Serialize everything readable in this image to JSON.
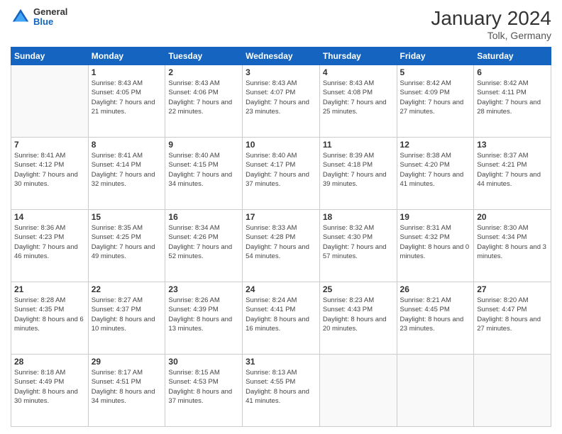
{
  "header": {
    "logo_line1": "General",
    "logo_line2": "Blue",
    "title": "January 2024",
    "subtitle": "Tolk, Germany"
  },
  "weekdays": [
    "Sunday",
    "Monday",
    "Tuesday",
    "Wednesday",
    "Thursday",
    "Friday",
    "Saturday"
  ],
  "weeks": [
    [
      {
        "day": "",
        "sunrise": "",
        "sunset": "",
        "daylight": ""
      },
      {
        "day": "1",
        "sunrise": "Sunrise: 8:43 AM",
        "sunset": "Sunset: 4:05 PM",
        "daylight": "Daylight: 7 hours and 21 minutes."
      },
      {
        "day": "2",
        "sunrise": "Sunrise: 8:43 AM",
        "sunset": "Sunset: 4:06 PM",
        "daylight": "Daylight: 7 hours and 22 minutes."
      },
      {
        "day": "3",
        "sunrise": "Sunrise: 8:43 AM",
        "sunset": "Sunset: 4:07 PM",
        "daylight": "Daylight: 7 hours and 23 minutes."
      },
      {
        "day": "4",
        "sunrise": "Sunrise: 8:43 AM",
        "sunset": "Sunset: 4:08 PM",
        "daylight": "Daylight: 7 hours and 25 minutes."
      },
      {
        "day": "5",
        "sunrise": "Sunrise: 8:42 AM",
        "sunset": "Sunset: 4:09 PM",
        "daylight": "Daylight: 7 hours and 27 minutes."
      },
      {
        "day": "6",
        "sunrise": "Sunrise: 8:42 AM",
        "sunset": "Sunset: 4:11 PM",
        "daylight": "Daylight: 7 hours and 28 minutes."
      }
    ],
    [
      {
        "day": "7",
        "sunrise": "Sunrise: 8:41 AM",
        "sunset": "Sunset: 4:12 PM",
        "daylight": "Daylight: 7 hours and 30 minutes."
      },
      {
        "day": "8",
        "sunrise": "Sunrise: 8:41 AM",
        "sunset": "Sunset: 4:14 PM",
        "daylight": "Daylight: 7 hours and 32 minutes."
      },
      {
        "day": "9",
        "sunrise": "Sunrise: 8:40 AM",
        "sunset": "Sunset: 4:15 PM",
        "daylight": "Daylight: 7 hours and 34 minutes."
      },
      {
        "day": "10",
        "sunrise": "Sunrise: 8:40 AM",
        "sunset": "Sunset: 4:17 PM",
        "daylight": "Daylight: 7 hours and 37 minutes."
      },
      {
        "day": "11",
        "sunrise": "Sunrise: 8:39 AM",
        "sunset": "Sunset: 4:18 PM",
        "daylight": "Daylight: 7 hours and 39 minutes."
      },
      {
        "day": "12",
        "sunrise": "Sunrise: 8:38 AM",
        "sunset": "Sunset: 4:20 PM",
        "daylight": "Daylight: 7 hours and 41 minutes."
      },
      {
        "day": "13",
        "sunrise": "Sunrise: 8:37 AM",
        "sunset": "Sunset: 4:21 PM",
        "daylight": "Daylight: 7 hours and 44 minutes."
      }
    ],
    [
      {
        "day": "14",
        "sunrise": "Sunrise: 8:36 AM",
        "sunset": "Sunset: 4:23 PM",
        "daylight": "Daylight: 7 hours and 46 minutes."
      },
      {
        "day": "15",
        "sunrise": "Sunrise: 8:35 AM",
        "sunset": "Sunset: 4:25 PM",
        "daylight": "Daylight: 7 hours and 49 minutes."
      },
      {
        "day": "16",
        "sunrise": "Sunrise: 8:34 AM",
        "sunset": "Sunset: 4:26 PM",
        "daylight": "Daylight: 7 hours and 52 minutes."
      },
      {
        "day": "17",
        "sunrise": "Sunrise: 8:33 AM",
        "sunset": "Sunset: 4:28 PM",
        "daylight": "Daylight: 7 hours and 54 minutes."
      },
      {
        "day": "18",
        "sunrise": "Sunrise: 8:32 AM",
        "sunset": "Sunset: 4:30 PM",
        "daylight": "Daylight: 7 hours and 57 minutes."
      },
      {
        "day": "19",
        "sunrise": "Sunrise: 8:31 AM",
        "sunset": "Sunset: 4:32 PM",
        "daylight": "Daylight: 8 hours and 0 minutes."
      },
      {
        "day": "20",
        "sunrise": "Sunrise: 8:30 AM",
        "sunset": "Sunset: 4:34 PM",
        "daylight": "Daylight: 8 hours and 3 minutes."
      }
    ],
    [
      {
        "day": "21",
        "sunrise": "Sunrise: 8:28 AM",
        "sunset": "Sunset: 4:35 PM",
        "daylight": "Daylight: 8 hours and 6 minutes."
      },
      {
        "day": "22",
        "sunrise": "Sunrise: 8:27 AM",
        "sunset": "Sunset: 4:37 PM",
        "daylight": "Daylight: 8 hours and 10 minutes."
      },
      {
        "day": "23",
        "sunrise": "Sunrise: 8:26 AM",
        "sunset": "Sunset: 4:39 PM",
        "daylight": "Daylight: 8 hours and 13 minutes."
      },
      {
        "day": "24",
        "sunrise": "Sunrise: 8:24 AM",
        "sunset": "Sunset: 4:41 PM",
        "daylight": "Daylight: 8 hours and 16 minutes."
      },
      {
        "day": "25",
        "sunrise": "Sunrise: 8:23 AM",
        "sunset": "Sunset: 4:43 PM",
        "daylight": "Daylight: 8 hours and 20 minutes."
      },
      {
        "day": "26",
        "sunrise": "Sunrise: 8:21 AM",
        "sunset": "Sunset: 4:45 PM",
        "daylight": "Daylight: 8 hours and 23 minutes."
      },
      {
        "day": "27",
        "sunrise": "Sunrise: 8:20 AM",
        "sunset": "Sunset: 4:47 PM",
        "daylight": "Daylight: 8 hours and 27 minutes."
      }
    ],
    [
      {
        "day": "28",
        "sunrise": "Sunrise: 8:18 AM",
        "sunset": "Sunset: 4:49 PM",
        "daylight": "Daylight: 8 hours and 30 minutes."
      },
      {
        "day": "29",
        "sunrise": "Sunrise: 8:17 AM",
        "sunset": "Sunset: 4:51 PM",
        "daylight": "Daylight: 8 hours and 34 minutes."
      },
      {
        "day": "30",
        "sunrise": "Sunrise: 8:15 AM",
        "sunset": "Sunset: 4:53 PM",
        "daylight": "Daylight: 8 hours and 37 minutes."
      },
      {
        "day": "31",
        "sunrise": "Sunrise: 8:13 AM",
        "sunset": "Sunset: 4:55 PM",
        "daylight": "Daylight: 8 hours and 41 minutes."
      },
      {
        "day": "",
        "sunrise": "",
        "sunset": "",
        "daylight": ""
      },
      {
        "day": "",
        "sunrise": "",
        "sunset": "",
        "daylight": ""
      },
      {
        "day": "",
        "sunrise": "",
        "sunset": "",
        "daylight": ""
      }
    ]
  ]
}
